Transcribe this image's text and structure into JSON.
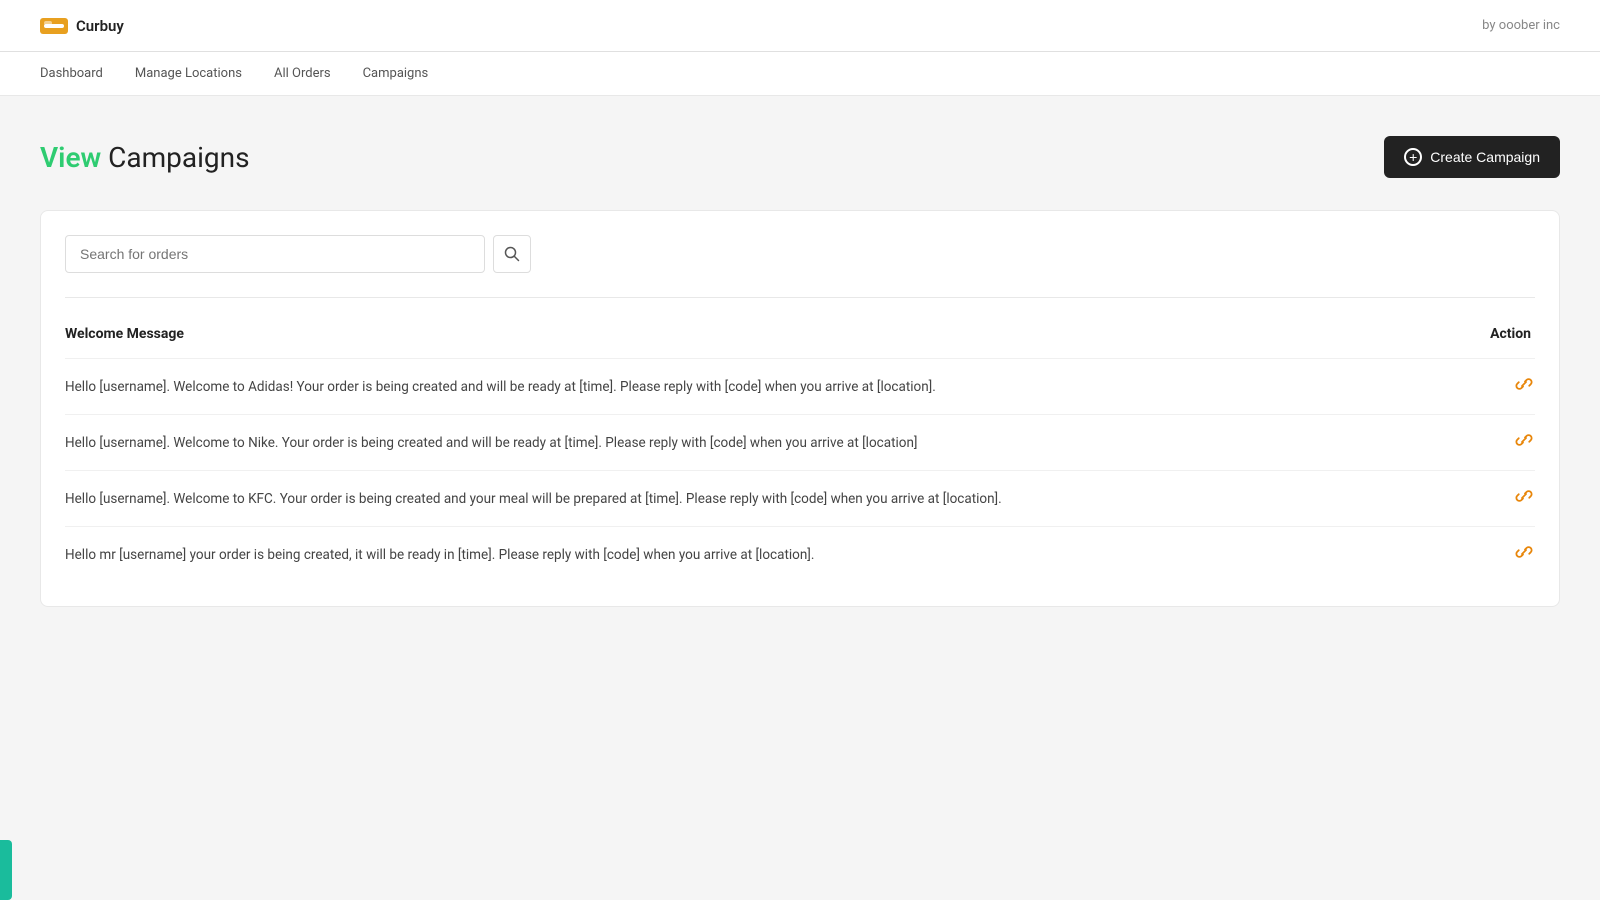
{
  "topbar": {
    "logo_text": "Curbuy",
    "brand_text": "by ooober inc"
  },
  "nav": {
    "items": [
      {
        "label": "Dashboard",
        "id": "dashboard"
      },
      {
        "label": "Manage Locations",
        "id": "manage-locations"
      },
      {
        "label": "All Orders",
        "id": "all-orders"
      },
      {
        "label": "Campaigns",
        "id": "campaigns"
      }
    ]
  },
  "page": {
    "title_accent": "View",
    "title_rest": " Campaigns",
    "create_btn_label": "Create Campaign"
  },
  "search": {
    "placeholder": "Search for orders"
  },
  "table": {
    "col_message": "Welcome Message",
    "col_action": "Action",
    "rows": [
      {
        "message": "Hello [username]. Welcome to Adidas! Your order is being created and will be ready at [time]. Please reply with [code] when you arrive at [location]."
      },
      {
        "message": "Hello [username]. Welcome to Nike. Your order is being created and will be ready at [time]. Please reply with [code] when you arrive at [location]"
      },
      {
        "message": "Hello [username]. Welcome to KFC. Your order is being created and your meal will be prepared at [time]. Please reply with [code] when you arrive at [location]."
      },
      {
        "message": "Hello mr [username] your order is being created, it will be ready in [time]. Please reply with [code] when you arrive at [location]."
      }
    ]
  },
  "icons": {
    "search": "🔍",
    "link": "🔗",
    "plus_circle": "⊕"
  }
}
